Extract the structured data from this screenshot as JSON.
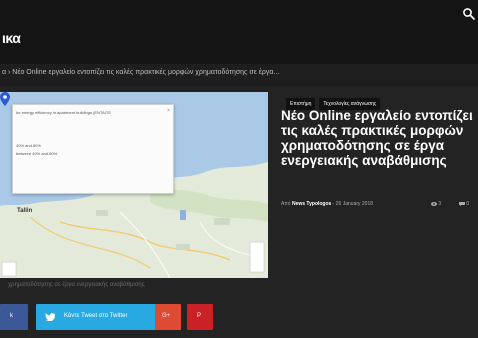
{
  "header": {
    "logo_text": "ικα",
    "search_icon": "search-icon"
  },
  "breadcrumb": {
    "text": "α  ›  Νέο Online εργαλείο εντοπίζει τις καλές πρακτικές μορφών χρηματοδότησης σε έργα..."
  },
  "featured": {
    "popup_title": "for energy efficiency in apartment buildings (ENTAITE",
    "popup_line1": "40% and 80%",
    "popup_line2": "between 40% and 80%",
    "popup_close": "×",
    "city": "Tallin",
    "caption": "χρηματοδότησης σε έργα ενεργειακής αναβάθμισης"
  },
  "article": {
    "tags": [
      "Επιστήμη",
      "Τεχνολογίες ανάγνωσης"
    ],
    "title": "Νέο Online εργαλείο εντοπίζει τις καλές πρακτικές μορφών χρηματοδότησης σε έργα ενεργειακής αναβάθμισης",
    "meta_prefix": "Από",
    "author": "News Typologos",
    "date": "- 26 January 2018",
    "views": "3",
    "comments": "0"
  },
  "share": {
    "facebook_label": "k",
    "twitter_label": "Κάντε Tweet στο Twitter",
    "googleplus_label": "G+",
    "pinterest_label": "P"
  },
  "colors": {
    "facebook": "#3b5998",
    "twitter": "#29a9e1",
    "googleplus": "#df4a32",
    "pinterest": "#ca2127"
  }
}
